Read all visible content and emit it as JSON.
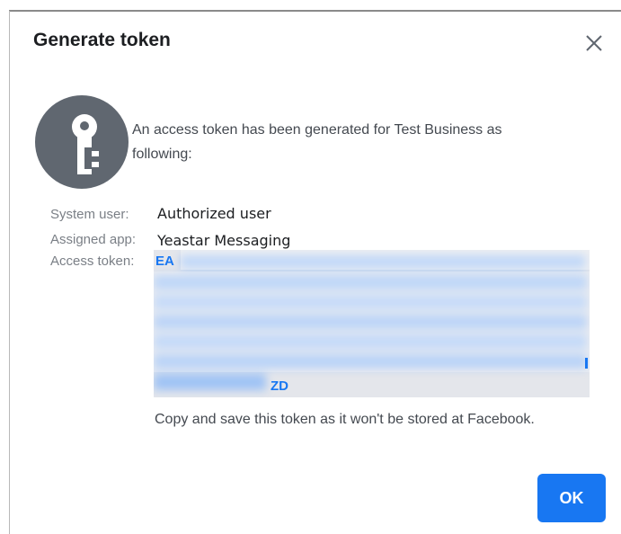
{
  "dialog": {
    "title": "Generate token",
    "intro_line1": "An access token has been generated for Test Business as",
    "intro_line2": "following:",
    "icons": {
      "key": "key-icon",
      "close": "close-icon"
    },
    "fields": {
      "system_user_label": "System user:",
      "system_user_value": "Authorized user",
      "assigned_app_label": "Assigned app:",
      "assigned_app_value": "Yeastar Messaging",
      "access_token_label": "Access token:",
      "access_token_start": "EA",
      "access_token_end": "ZD"
    },
    "copy_note": "Copy and save this token as it won't be stored at Facebook.",
    "ok_label": "OK"
  },
  "colors": {
    "accent": "#1877f2",
    "icon_bg": "#606770",
    "token_bg": "#e4e6eb"
  }
}
